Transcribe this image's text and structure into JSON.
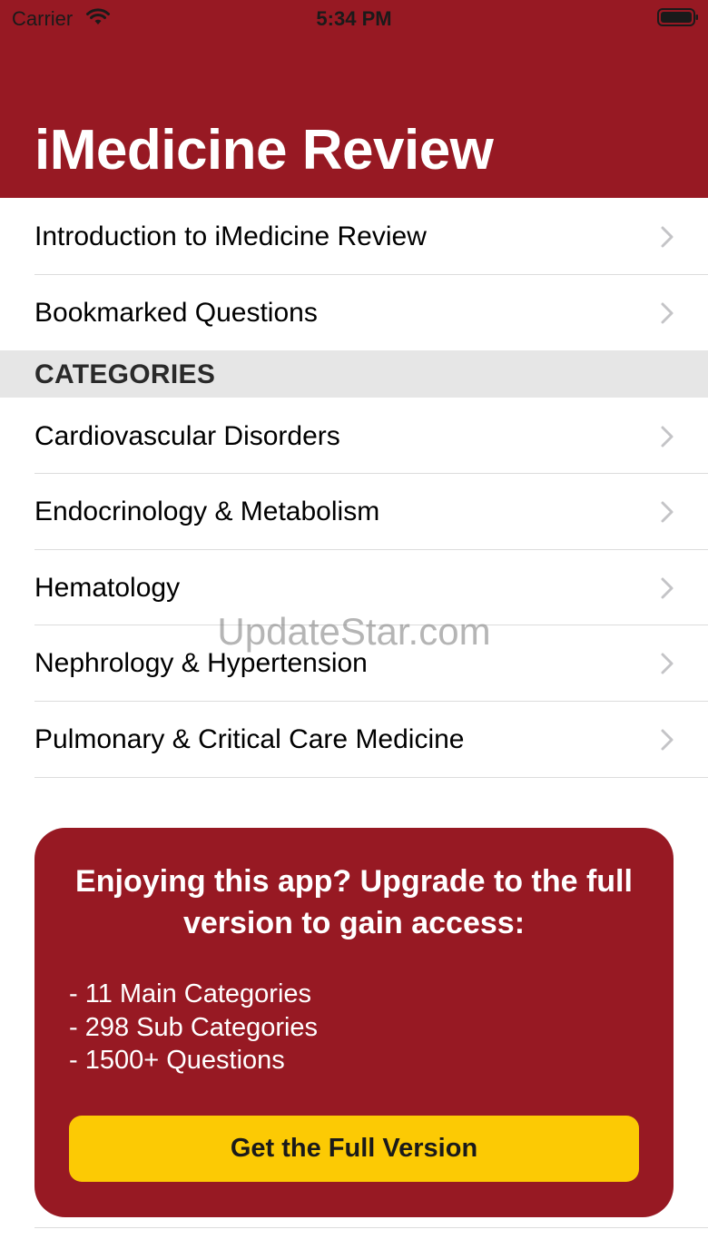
{
  "status_bar": {
    "carrier": "Carrier",
    "time": "5:34 PM"
  },
  "nav": {
    "title": "iMedicine Review"
  },
  "top_items": [
    {
      "label": "Introduction to iMedicine Review",
      "icon": "chevron-right-icon"
    },
    {
      "label": "Bookmarked Questions",
      "icon": "chevron-right-icon"
    }
  ],
  "categories": {
    "header": "CATEGORIES",
    "items": [
      {
        "label": "Cardiovascular Disorders",
        "icon": "chevron-right-icon"
      },
      {
        "label": "Endocrinology & Metabolism",
        "icon": "chevron-right-icon"
      },
      {
        "label": "Hematology",
        "icon": "chevron-right-icon"
      },
      {
        "label": "Nephrology & Hypertension",
        "icon": "chevron-right-icon"
      },
      {
        "label": "Pulmonary & Critical Care Medicine",
        "icon": "chevron-right-icon"
      }
    ]
  },
  "watermark": "UpdateStar.com",
  "promo": {
    "title": "Enjoying this app? Upgrade to the full version to gain access:",
    "features": [
      "- 11 Main Categories",
      "- 298 Sub Categories",
      "- 1500+ Questions"
    ],
    "button_label": "Get the Full Version"
  },
  "colors": {
    "brand": "#971923",
    "button": "#fcca04",
    "section_bg": "#e6e6e6"
  }
}
